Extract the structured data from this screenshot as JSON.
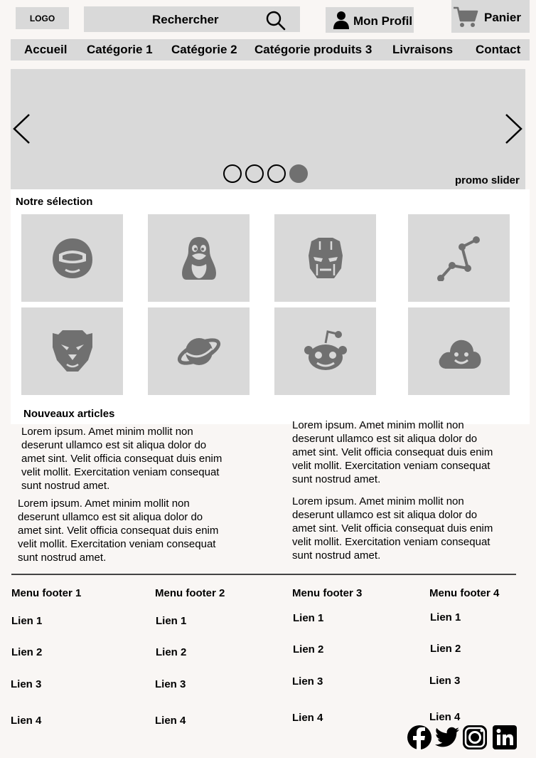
{
  "header": {
    "logo": "LOGO",
    "search_label": "Rechercher",
    "profile_label": "Mon Profil",
    "cart_label": "Panier"
  },
  "nav": {
    "items": [
      "Accueil",
      "Catégorie 1",
      "Catégorie 2",
      "Catégorie produits 3",
      "Livraisons",
      "Contact"
    ]
  },
  "slider": {
    "label": "promo slider",
    "slides_total": 4,
    "active_slide": 4
  },
  "selection": {
    "title": "Notre sélection",
    "icons": [
      "astronaut-icon",
      "penguin-icon",
      "iron-man-icon",
      "constellation-icon",
      "lion-icon",
      "planet-icon",
      "reddit-icon",
      "cloud-smile-icon"
    ]
  },
  "articles": {
    "title": "Nouveaux articles",
    "items": [
      "Lorem ipsum. Amet minim mollit non deserunt ullamco est sit aliqua dolor do amet sint. Velit officia consequat duis enim velit mollit. Exercitation veniam consequat sunt nostrud amet.",
      "Lorem ipsum. Amet minim mollit non deserunt ullamco est sit aliqua dolor do amet sint. Velit officia consequat duis enim velit mollit. Exercitation veniam consequat sunt nostrud amet.",
      "Lorem ipsum. Amet minim mollit non deserunt ullamco est sit aliqua dolor do amet sint. Velit officia consequat duis enim velit mollit. Exercitation veniam consequat sunt nostrud amet.",
      "Lorem ipsum. Amet minim mollit non deserunt ullamco est sit aliqua dolor do amet sint. Velit officia consequat duis enim velit mollit. Exercitation veniam consequat sunt nostrud amet."
    ]
  },
  "footer": {
    "menus": [
      {
        "title": "Menu footer 1",
        "links": [
          "Lien 1",
          "Lien 2",
          "Lien 3",
          "Lien 4"
        ]
      },
      {
        "title": "Menu footer 2",
        "links": [
          "Lien 1",
          "Lien 2",
          "Lien 3",
          "Lien 4"
        ]
      },
      {
        "title": "Menu footer 3",
        "links": [
          "Lien 1",
          "Lien 2",
          "Lien 3",
          "Lien 4"
        ]
      },
      {
        "title": "Menu footer 4",
        "links": [
          "Lien 1",
          "Lien 2",
          "Lien 3",
          "Lien 4"
        ]
      }
    ],
    "social": [
      "facebook-icon",
      "twitter-icon",
      "instagram-icon",
      "linkedin-icon"
    ]
  },
  "colors": {
    "page_bg": "#f9f6f4",
    "block_grey": "#d9d9d9",
    "icon_grey": "#707070"
  }
}
